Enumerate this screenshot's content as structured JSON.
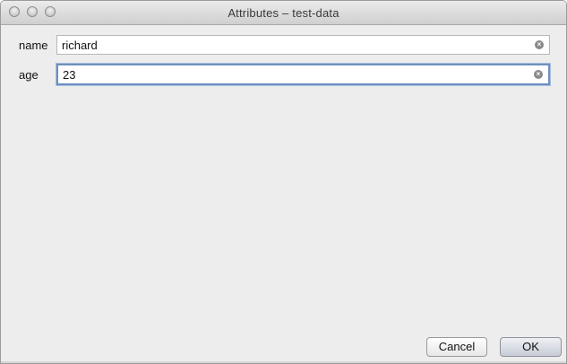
{
  "window": {
    "title": "Attributes – test-data"
  },
  "fields": [
    {
      "label": "name",
      "value": "richard"
    },
    {
      "label": "age",
      "value": "23"
    }
  ],
  "buttons": {
    "cancel": "Cancel",
    "ok": "OK"
  },
  "icons": {
    "clear": "clear-field-icon"
  }
}
